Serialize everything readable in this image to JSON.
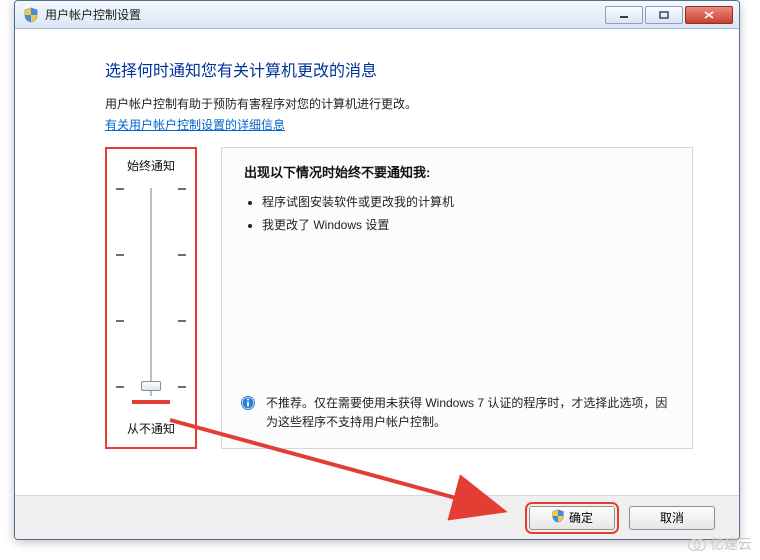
{
  "window": {
    "title": "用户帐户控制设置"
  },
  "heading": "选择何时通知您有关计算机更改的消息",
  "explain": "用户帐户控制有助于预防有害程序对您的计算机进行更改。",
  "link": "有关用户帐户控制设置的详细信息",
  "slider": {
    "top_label": "始终通知",
    "bottom_label": "从不通知"
  },
  "info": {
    "title": "出现以下情况时始终不要通知我:",
    "bullets": [
      "程序试图安装软件或更改我的计算机",
      "我更改了 Windows 设置"
    ],
    "recommend": "不推荐。仅在需要使用未获得 Windows 7 认证的程序时，才选择此选项，因为这些程序不支持用户帐户控制。"
  },
  "buttons": {
    "ok": "确定",
    "cancel": "取消"
  },
  "watermark": "亿速云"
}
